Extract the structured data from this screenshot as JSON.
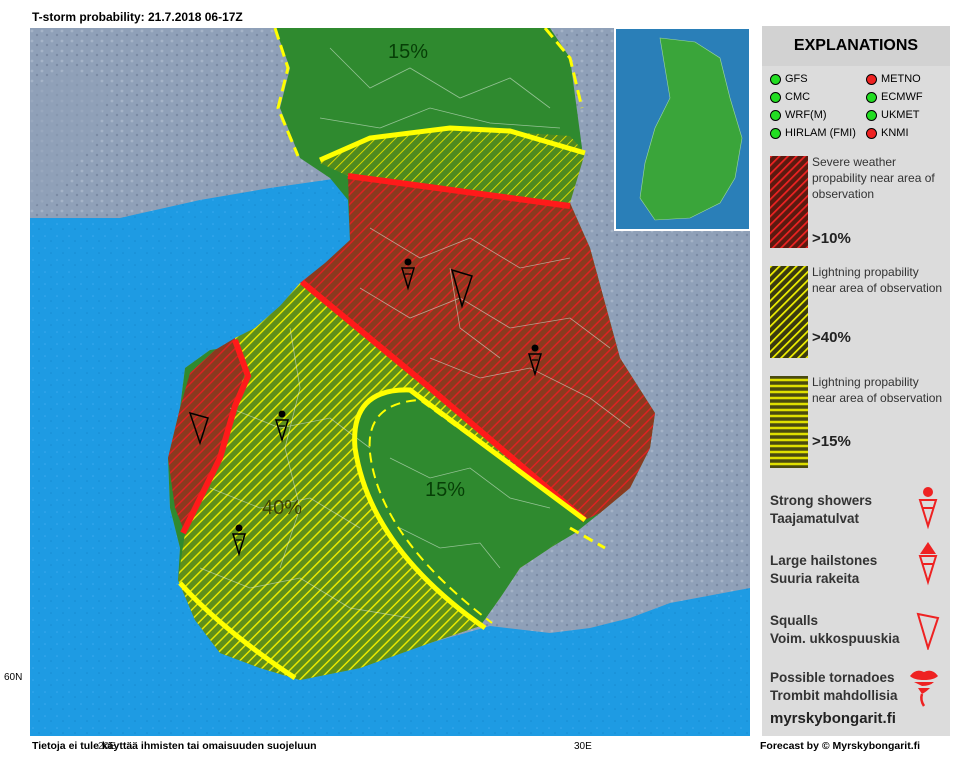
{
  "title": "T-storm probability: 21.7.2018 06-17Z",
  "panel": {
    "heading": "EXPLANATIONS",
    "models": [
      {
        "name": "GFS",
        "status_color": "#22dd22"
      },
      {
        "name": "METNO",
        "status_color": "#ee2222"
      },
      {
        "name": "CMC",
        "status_color": "#22dd22"
      },
      {
        "name": "ECMWF",
        "status_color": "#22dd22"
      },
      {
        "name": "WRF(M)",
        "status_color": "#22dd22"
      },
      {
        "name": "UKMET",
        "status_color": "#22dd22"
      },
      {
        "name": "HIRLAM (FMI)",
        "status_color": "#22dd22"
      },
      {
        "name": "KNMI",
        "status_color": "#ee2222"
      }
    ],
    "legend": [
      {
        "text": "Severe weather propability near area of observation",
        "value": ">10%",
        "color": "#dd2222"
      },
      {
        "text": "Lightning propability near area of observation",
        "value": ">40%",
        "color": "#e6e600"
      },
      {
        "text": "Lightning propability near area of observation",
        "value": ">15%",
        "color": "#dddd00"
      }
    ],
    "symbols": [
      {
        "en": "Strong showers",
        "fi": "Taajamatulvat",
        "icon": "shower-icon"
      },
      {
        "en": "Large hailstones",
        "fi": "Suuria rakeita",
        "icon": "hail-icon"
      },
      {
        "en": "Squalls",
        "fi": "Voim. ukkospuuskia",
        "icon": "squall-icon"
      },
      {
        "en": "Possible tornadoes",
        "fi": "Trombit mahdollisia",
        "icon": "tornado-icon"
      }
    ],
    "site": "myrskybongarit.fi"
  },
  "map": {
    "labels": {
      "north": "15%",
      "east": "15%",
      "southwest": "40%"
    },
    "colors": {
      "sea": "#1e9be3",
      "land": "#2f8a2f",
      "severe": "#dd2222",
      "lightning": "#e6e600"
    },
    "axis": {
      "lat_60": "60N",
      "lon_30": "30E",
      "lon_20": "20E"
    }
  },
  "footer": {
    "left": "Tietoja ei tule käyttää ihmisten     tai omaisuuden suojeluun",
    "right": "Forecast by © Myrskybongarit.fi"
  }
}
